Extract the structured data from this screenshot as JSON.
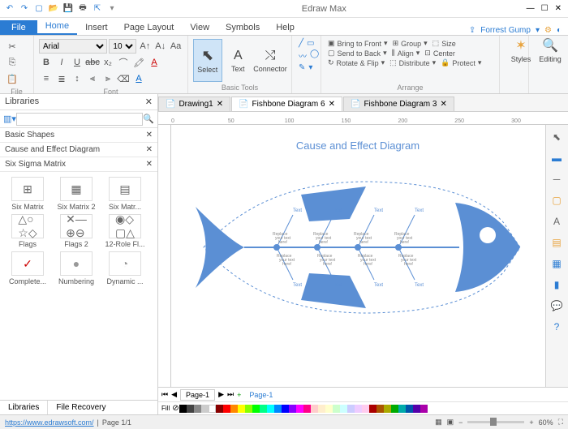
{
  "app": {
    "title": "Edraw Max"
  },
  "qat": [
    "back-icon",
    "forward-icon",
    "new-icon",
    "open-icon",
    "save-icon",
    "print-icon",
    "export-icon",
    "more-icon"
  ],
  "tabs": {
    "file": "File",
    "items": [
      "Home",
      "Insert",
      "Page Layout",
      "View",
      "Symbols",
      "Help"
    ],
    "active": "Home"
  },
  "user": {
    "name": "Forrest Gump"
  },
  "ribbon": {
    "file_group": "File",
    "font": {
      "name": "Arial",
      "size": "10",
      "label": "Font"
    },
    "tools": {
      "select": "Select",
      "text": "Text",
      "connector": "Connector",
      "label": "Basic Tools"
    },
    "arrange": {
      "bring": "Bring to Front",
      "send": "Send to Back",
      "rotate": "Rotate & Flip",
      "group": "Group",
      "align": "Align",
      "distribute": "Distribute",
      "size": "Size",
      "center": "Center",
      "protect": "Protect",
      "label": "Arrange"
    },
    "styles": "Styles",
    "editing": "Editing"
  },
  "sidebar": {
    "title": "Libraries",
    "search_placeholder": "",
    "cats": [
      "Basic Shapes",
      "Cause and Effect Diagram",
      "Six Sigma Matrix"
    ],
    "shapes1": [
      "Six Matrix",
      "Six Matrix 2",
      "Six Matr..."
    ],
    "shapes2": [
      "Flags",
      "Flags 2",
      "12-Role Fl..."
    ],
    "shapes3": [
      "Complete...",
      "Numbering",
      "Dynamic ..."
    ],
    "footer": [
      "Libraries",
      "File Recovery"
    ]
  },
  "docs": {
    "tabs": [
      "Drawing1",
      "Fishbone Diagram 6",
      "Fishbone Diagram 3"
    ],
    "active": "Fishbone Diagram 6"
  },
  "canvas": {
    "title": "Cause and Effect Diagram",
    "bone_label": "Text",
    "placeholder": "Replace your text here!"
  },
  "pagetabs": {
    "page1": "Page-1",
    "page1b": "Page-1"
  },
  "fill_label": "Fill",
  "status": {
    "url": "https://www.edrawsoft.com/",
    "page": "Page 1/1",
    "zoom": "60%"
  }
}
